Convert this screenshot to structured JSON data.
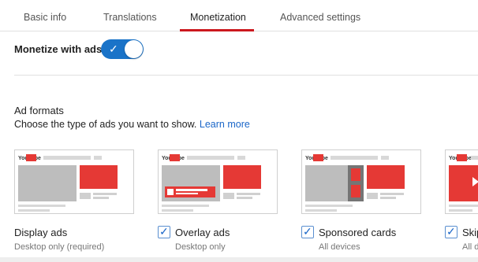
{
  "tabs": [
    {
      "label": "Basic info"
    },
    {
      "label": "Translations"
    },
    {
      "label": "Monetization",
      "active": true
    },
    {
      "label": "Advanced settings"
    }
  ],
  "monetize": {
    "label": "Monetize with ads",
    "enabled": true
  },
  "ad_formats": {
    "title": "Ad formats",
    "description": "Choose the type of ads you want to show.",
    "learn_more": "Learn more",
    "items": [
      {
        "label": "Display ads",
        "sub": "Desktop only (required)",
        "checked": null
      },
      {
        "label": "Overlay ads",
        "sub": "Desktop only",
        "checked": true
      },
      {
        "label": "Sponsored cards",
        "sub": "All devices",
        "checked": true
      },
      {
        "label": "Skip",
        "sub": "All d",
        "checked": true
      }
    ]
  },
  "colors": {
    "accent_red": "#cc181e",
    "toggle_blue": "#1a73c8",
    "link_blue": "#1a66c8",
    "ad_red": "#e53935",
    "placeholder_gray": "#bdbdbd"
  },
  "thumbnail_logo": "YouTube"
}
